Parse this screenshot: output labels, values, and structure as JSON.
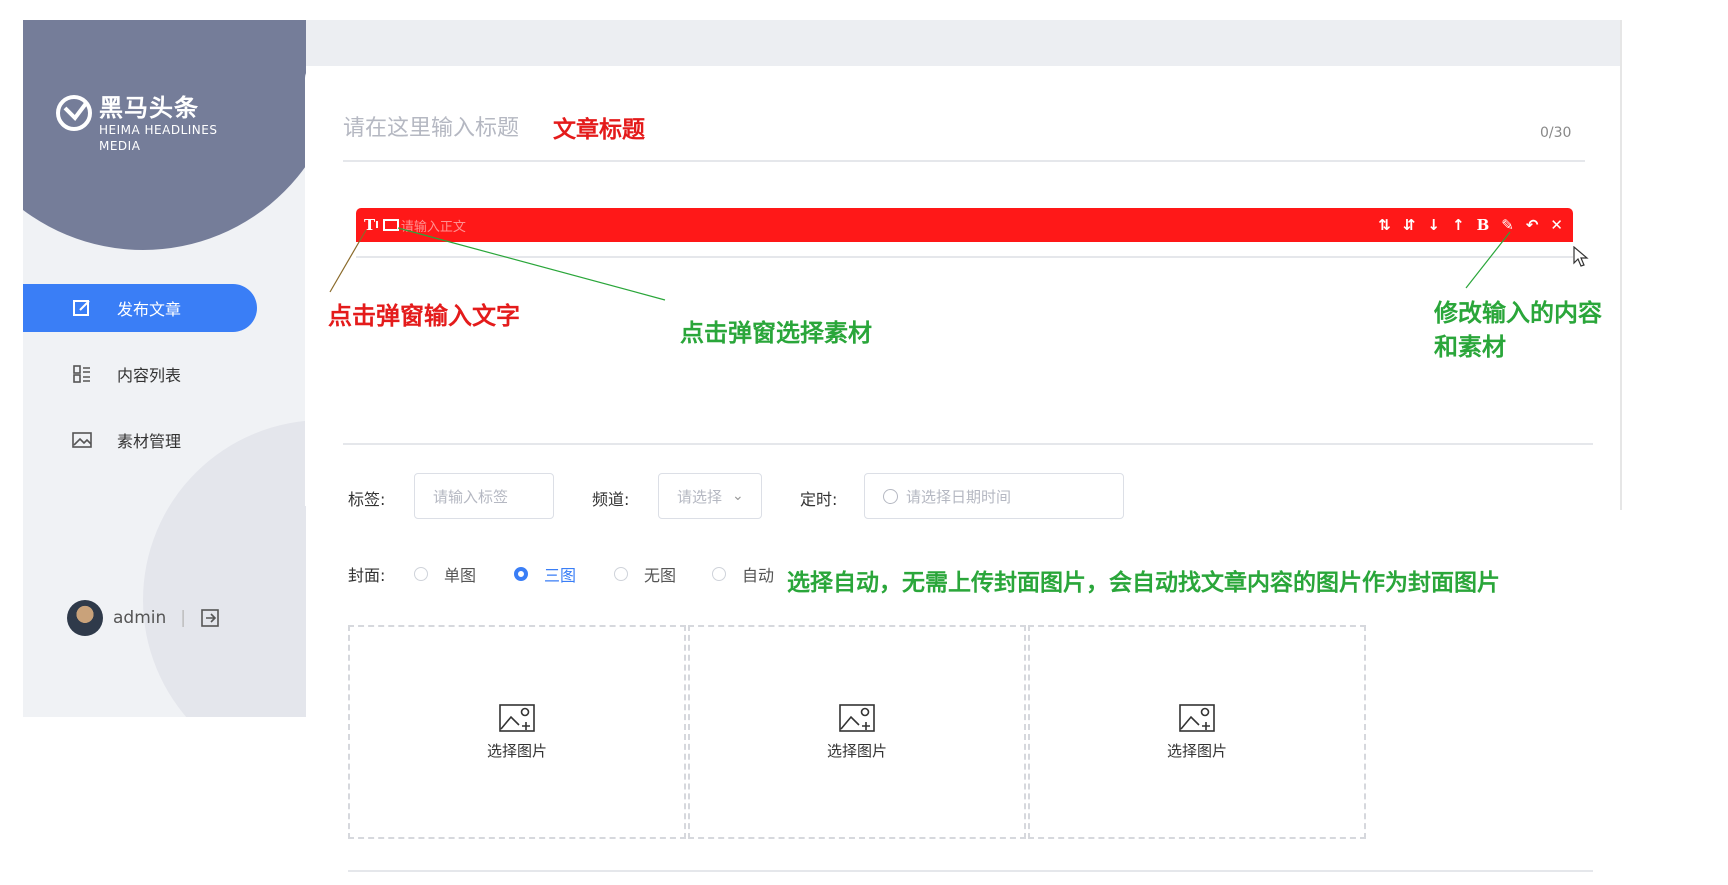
{
  "sidebar": {
    "logo": {
      "title": "黑马头条",
      "subtitle_line1": "HEIMA HEADLINES",
      "subtitle_line2": "MEDIA"
    },
    "items": [
      {
        "label": "发布文章",
        "icon": "edit-icon",
        "active": true
      },
      {
        "label": "内容列表",
        "icon": "list-icon",
        "active": false
      },
      {
        "label": "素材管理",
        "icon": "image-icon",
        "active": false
      }
    ],
    "user": {
      "name": "admin",
      "separator": "|"
    }
  },
  "title": {
    "placeholder": "请在这里输入标题",
    "annotation": "文章标题",
    "count": "0/30"
  },
  "editor": {
    "placeholder": "请输入正文",
    "text_tool": "T",
    "bold_tool": "B"
  },
  "annotations": {
    "text_popup": "点击弹窗输入文字",
    "material_popup": "点击弹窗选择素材",
    "edit_line1": "修改输入的内容",
    "edit_line2": "和素材",
    "auto_cover": "选择自动，无需上传封面图片，会自动找文章内容的图片作为封面图片"
  },
  "form": {
    "tag_label": "标签:",
    "tag_placeholder": "请输入标签",
    "channel_label": "频道:",
    "channel_placeholder": "请选择",
    "timer_label": "定时:",
    "timer_placeholder": "请选择日期时间"
  },
  "cover": {
    "label": "封面:",
    "options": [
      {
        "label": "单图",
        "checked": false
      },
      {
        "label": "三图",
        "checked": true
      },
      {
        "label": "无图",
        "checked": false
      },
      {
        "label": "自动",
        "checked": false
      }
    ],
    "boxes": [
      {
        "caption": "选择图片"
      },
      {
        "caption": "选择图片"
      },
      {
        "caption": "选择图片"
      }
    ]
  },
  "colors": {
    "accent": "#3a7ef6",
    "toolbar": "#ff1818",
    "annotation_red": "#e41b1b",
    "annotation_green": "#2aa63a",
    "sidebar_header": "#757d99"
  }
}
